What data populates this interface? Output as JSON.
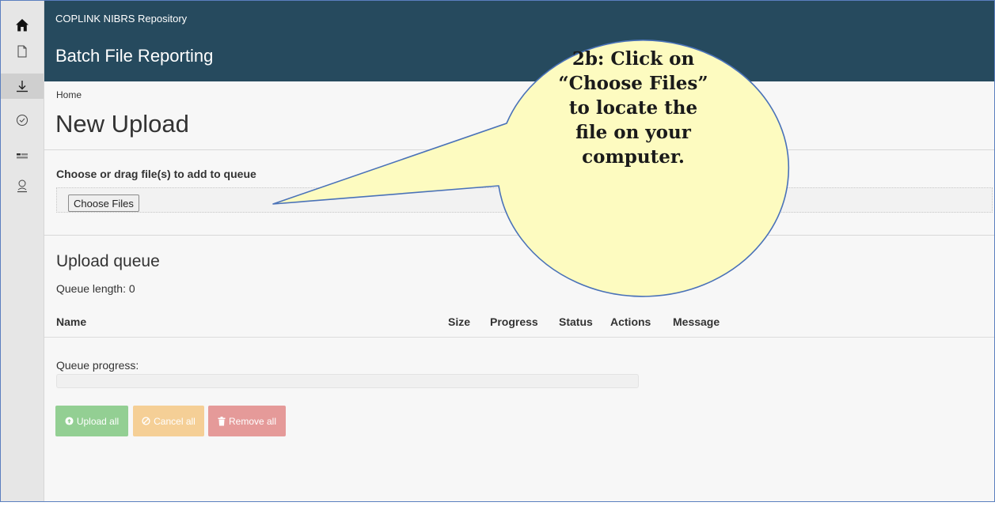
{
  "header": {
    "app_name": "COPLINK NIBRS Repository",
    "section_title": "Batch File Reporting"
  },
  "rail": {
    "items": [
      {
        "icon": "home-icon"
      },
      {
        "icon": "document-icon"
      },
      {
        "icon": "download-icon",
        "active": true
      },
      {
        "icon": "check-circle-icon"
      },
      {
        "icon": "list-icon"
      },
      {
        "icon": "user-icon"
      }
    ]
  },
  "main": {
    "breadcrumb": "Home",
    "page_title": "New Upload",
    "dropzone_label": "Choose or drag file(s) to add to queue",
    "choose_files_label": "Choose Files",
    "queue_title": "Upload queue",
    "queue_length": "Queue length: 0",
    "columns": {
      "name": "Name",
      "size": "Size",
      "progress": "Progress",
      "status": "Status",
      "actions": "Actions",
      "message": "Message"
    },
    "queue_progress_label": "Queue progress:",
    "queue_progress_value": 0,
    "buttons": {
      "upload_all": "Upload all",
      "cancel_all": "Cancel all",
      "remove_all": "Remove all"
    }
  },
  "callout": {
    "lines": [
      "2b: Click on",
      "“Choose Files”",
      "to locate the",
      "file on your",
      "computer."
    ]
  },
  "colors": {
    "header_bg": "#264a5e",
    "upload_button": "#93cf93",
    "cancel_button": "#f5cf96",
    "remove_button": "#e59a99",
    "callout_fill": "#fdfbc0",
    "callout_border": "#4a72b8"
  }
}
